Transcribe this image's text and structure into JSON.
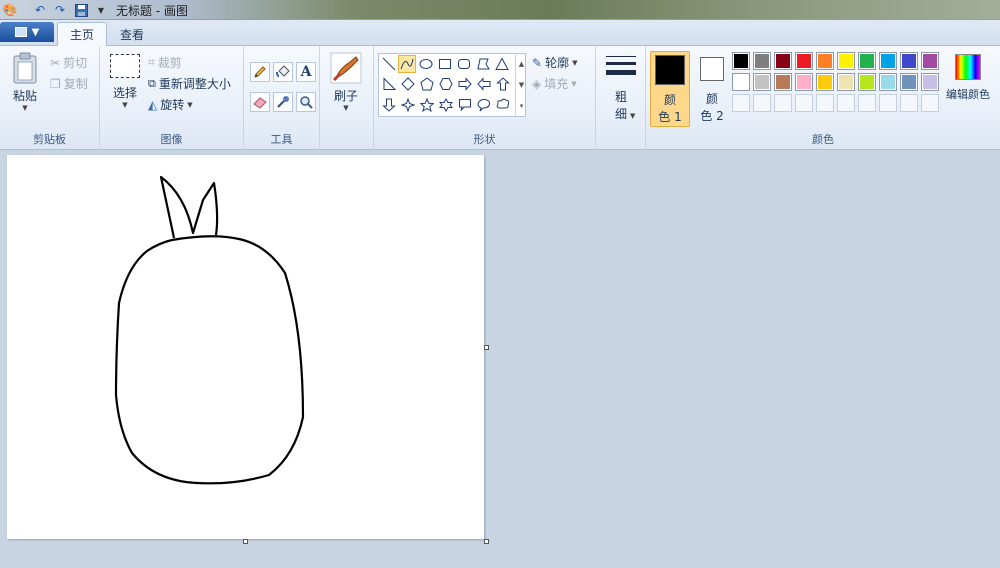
{
  "window": {
    "title": "无标题 - 画图"
  },
  "tabs": [
    {
      "label": "主页"
    },
    {
      "label": "查看"
    }
  ],
  "groups": {
    "clipboard": {
      "label": "剪贴板",
      "paste": "粘贴",
      "cut": "剪切",
      "copy": "复制"
    },
    "image": {
      "label": "图像",
      "select": "选择",
      "crop": "裁剪",
      "resize": "重新调整大小",
      "rotate": "旋转"
    },
    "tools": {
      "label": "工具",
      "text_glyph": "A"
    },
    "brushes": {
      "label": "刷子"
    },
    "shapes": {
      "label": "形状",
      "outline": "轮廓",
      "fill": "填充"
    },
    "size": {
      "label_top": "粗",
      "label_bottom": "细"
    },
    "colors": {
      "label": "颜色",
      "color1": {
        "label_top": "颜",
        "label_bottom": "色 1",
        "value": "#000000"
      },
      "color2": {
        "label_top": "颜",
        "label_bottom": "色 2",
        "value": "#ffffff"
      },
      "edit": "编辑颜色",
      "palette_row1": [
        "#000000",
        "#7f7f7f",
        "#880015",
        "#ed1c24",
        "#ff7f27",
        "#fff200",
        "#22b14c",
        "#00a2e8",
        "#3f48cc",
        "#a349a4"
      ],
      "palette_row2": [
        "#ffffff",
        "#c3c3c3",
        "#b97a57",
        "#ffaec9",
        "#ffc90e",
        "#efe4b0",
        "#b5e61d",
        "#99d9ea",
        "#7092be",
        "#c8bfe7"
      ]
    }
  },
  "canvas": {
    "background": "#ffffff",
    "stroke": "#000000"
  }
}
